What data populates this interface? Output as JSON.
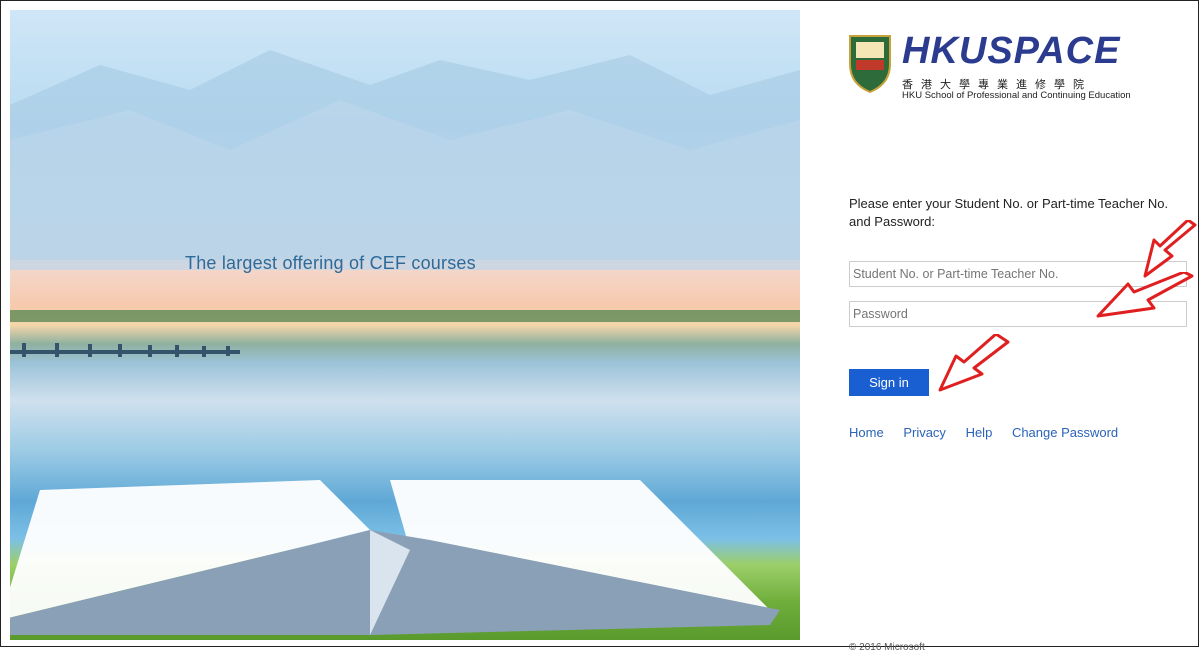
{
  "hero": {
    "tagline": "The largest offering of CEF courses"
  },
  "logo": {
    "brand": "HKUSPACE",
    "chinese": "香港大學專業進修學院",
    "english": "HKU School of Professional and Continuing Education"
  },
  "form": {
    "prompt": "Please enter your Student No. or Part-time Teacher No. and Password:",
    "username_placeholder": "Student No. or Part-time Teacher No.",
    "password_placeholder": "Password",
    "signin_label": "Sign in"
  },
  "links": {
    "home": "Home",
    "privacy": "Privacy",
    "help": "Help",
    "change_password": "Change Password"
  },
  "footer": {
    "copyright": "© 2016 Microsoft"
  },
  "colors": {
    "accent": "#1a5fd1",
    "link": "#2b63b8",
    "brand": "#2b3b8f",
    "annotation_arrow": "#e02020"
  }
}
